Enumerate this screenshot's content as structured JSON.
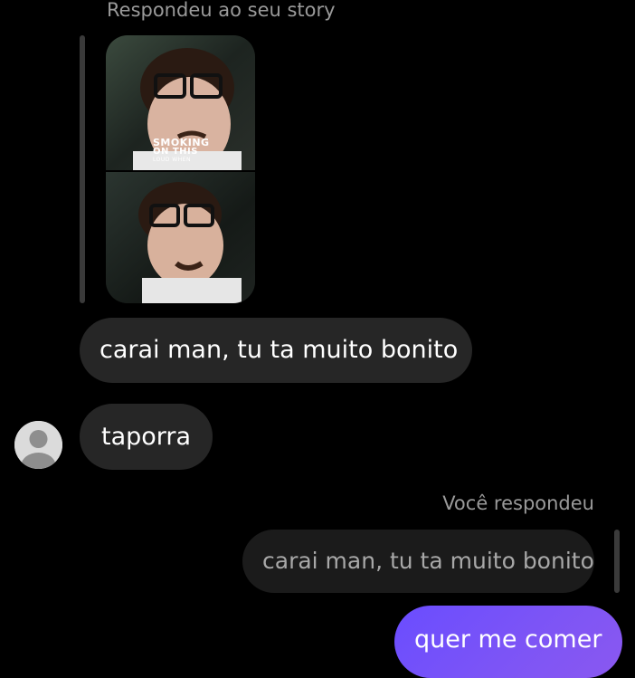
{
  "thread": {
    "story_reply_label": "Respondeu ao seu story",
    "story_thumbnail": {
      "caption_line1": "SMOKING",
      "caption_line2": "ON THIS",
      "caption_line3": "LOUD WHEN"
    },
    "messages": [
      {
        "sender": "them",
        "text": "carai man, tu ta muito bonito"
      },
      {
        "sender": "them",
        "text": "taporra"
      }
    ],
    "reply": {
      "meta_label": "Você respondeu",
      "quoted_text": "carai man, tu ta muito bonito",
      "sent_text": "quer me comer"
    },
    "colors": {
      "background": "#000000",
      "received_bubble": "#262626",
      "quoted_bubble": "#1b1b1b",
      "sent_bubble": "#7050f8",
      "muted_text": "#9a9a9a"
    }
  }
}
